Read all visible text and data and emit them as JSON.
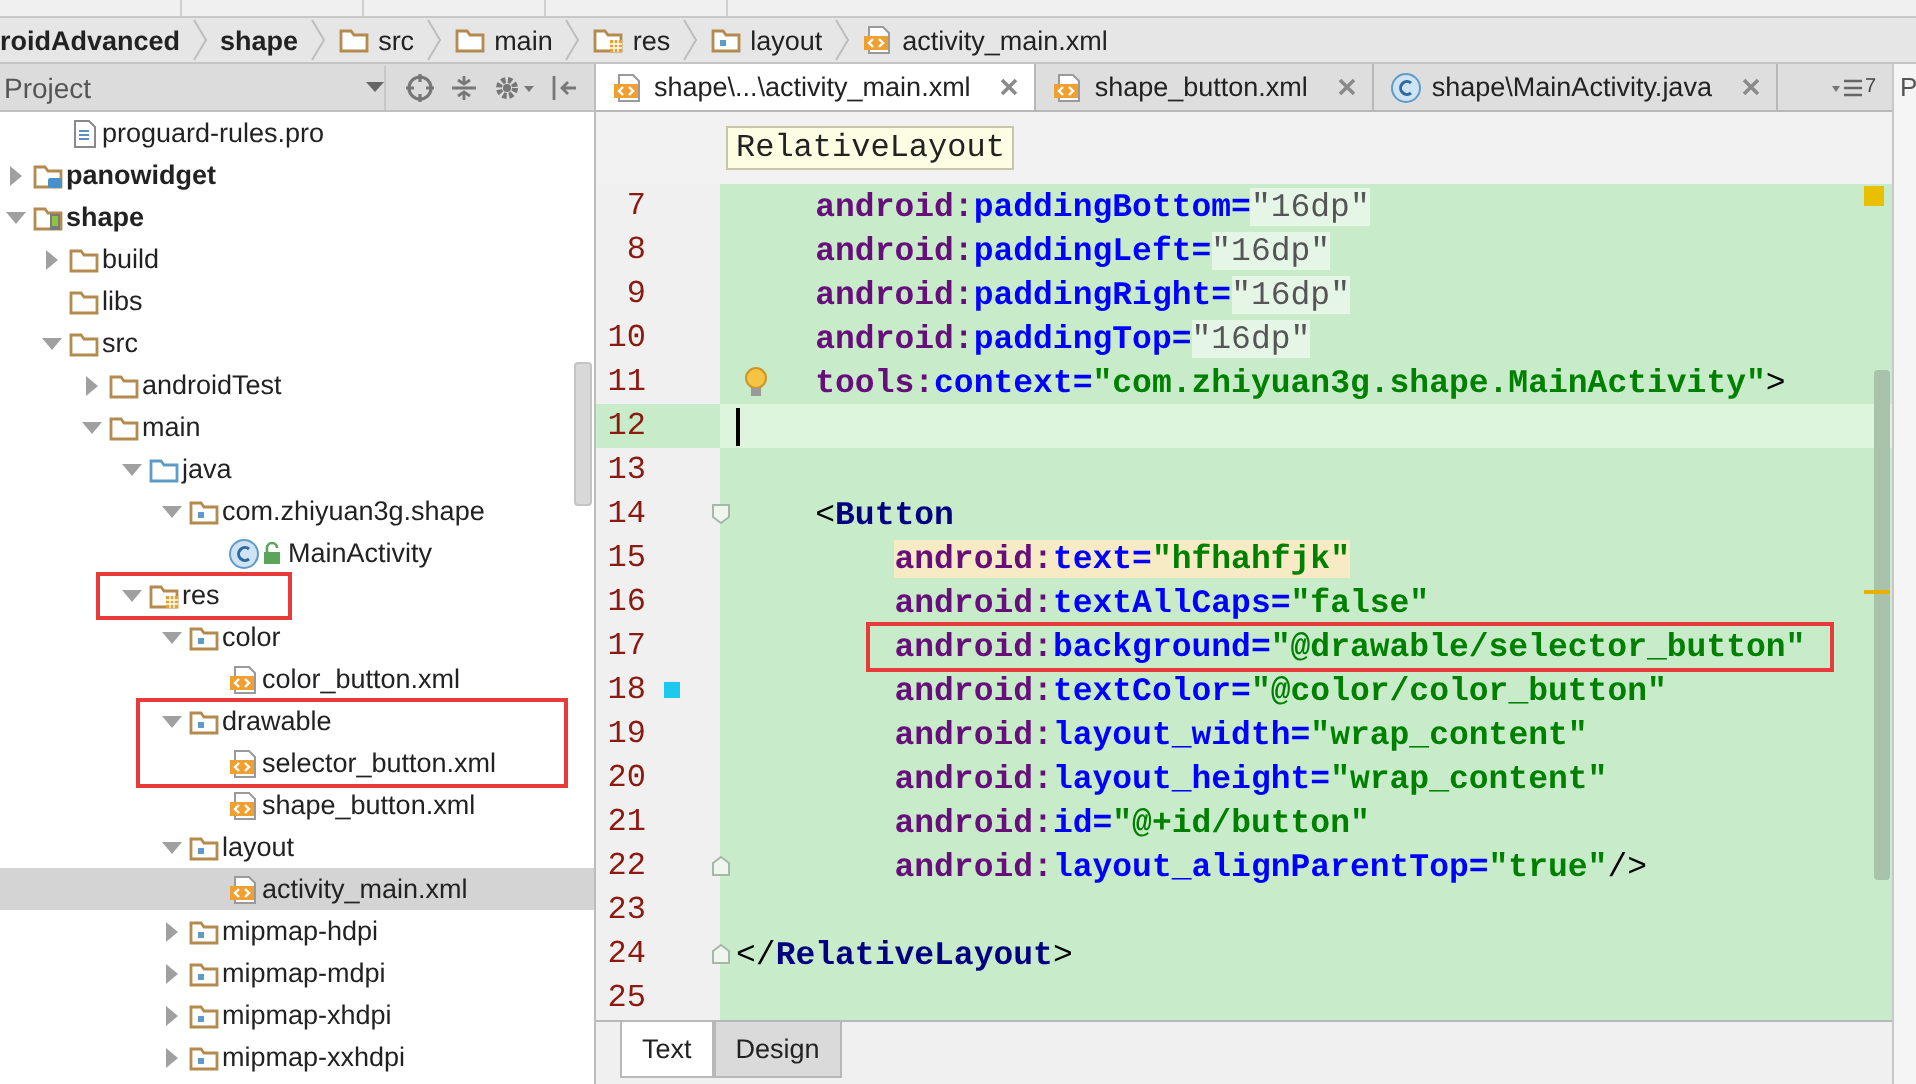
{
  "breadcrumbs": [
    {
      "label": "roidAdvanced",
      "kind": "project"
    },
    {
      "label": "shape",
      "kind": "module"
    },
    {
      "label": "src",
      "kind": "folder"
    },
    {
      "label": "main",
      "kind": "folder"
    },
    {
      "label": "res",
      "kind": "res"
    },
    {
      "label": "layout",
      "kind": "package"
    },
    {
      "label": "activity_main.xml",
      "kind": "xml"
    }
  ],
  "project_panel": {
    "title": "Project",
    "tree": {
      "continued": [
        {
          "label": "proguard-rules.pro",
          "kind": "text_file",
          "selected": false,
          "highlighted": false
        }
      ],
      "items": [
        {
          "label": "panowidget",
          "kind": "module_lib",
          "expanded": false,
          "selected": false,
          "highlighted": false
        },
        {
          "label": "shape",
          "kind": "module_app",
          "expanded": true,
          "selected": false,
          "highlighted": false,
          "children": [
            {
              "label": "build",
              "kind": "folder",
              "expanded": false,
              "selected": false,
              "highlighted": false
            },
            {
              "label": "libs",
              "kind": "folder",
              "selected": false,
              "highlighted": false
            },
            {
              "label": "src",
              "kind": "folder",
              "expanded": true,
              "selected": false,
              "highlighted": false,
              "children": [
                {
                  "label": "androidTest",
                  "kind": "folder",
                  "expanded": false,
                  "selected": false,
                  "highlighted": false
                },
                {
                  "label": "main",
                  "kind": "folder",
                  "expanded": true,
                  "selected": false,
                  "highlighted": false,
                  "children": [
                    {
                      "label": "java",
                      "kind": "source",
                      "expanded": true,
                      "selected": false,
                      "highlighted": false,
                      "children": [
                        {
                          "label": "com.zhiyuan3g.shape",
                          "kind": "package",
                          "expanded": true,
                          "selected": false,
                          "highlighted": false,
                          "children": [
                            {
                              "label": "MainActivity",
                              "kind": "class",
                              "selected": false,
                              "highlighted": false
                            }
                          ]
                        }
                      ]
                    },
                    {
                      "label": "res",
                      "kind": "res",
                      "expanded": true,
                      "selected": false,
                      "highlighted": true,
                      "children": [
                        {
                          "label": "color",
                          "kind": "package",
                          "expanded": true,
                          "selected": false,
                          "highlighted": false,
                          "children": [
                            {
                              "label": "color_button.xml",
                              "kind": "xml",
                              "selected": false,
                              "highlighted": false
                            }
                          ]
                        },
                        {
                          "label": "drawable",
                          "kind": "package",
                          "expanded": true,
                          "selected": false,
                          "highlighted": true,
                          "children": [
                            {
                              "label": "selector_button.xml",
                              "kind": "xml",
                              "selected": false,
                              "highlighted": true
                            },
                            {
                              "label": "shape_button.xml",
                              "kind": "xml",
                              "selected": false,
                              "highlighted": false
                            }
                          ]
                        },
                        {
                          "label": "layout",
                          "kind": "package",
                          "expanded": true,
                          "selected": false,
                          "highlighted": false,
                          "children": [
                            {
                              "label": "activity_main.xml",
                              "kind": "xml",
                              "selected": true,
                              "highlighted": false
                            }
                          ]
                        },
                        {
                          "label": "mipmap-hdpi",
                          "kind": "package",
                          "expanded": false,
                          "selected": false,
                          "highlighted": false
                        },
                        {
                          "label": "mipmap-mdpi",
                          "kind": "package",
                          "expanded": false,
                          "selected": false,
                          "highlighted": false
                        },
                        {
                          "label": "mipmap-xhdpi",
                          "kind": "package",
                          "expanded": false,
                          "selected": false,
                          "highlighted": false
                        },
                        {
                          "label": "mipmap-xxhdpi",
                          "kind": "package",
                          "expanded": false,
                          "selected": false,
                          "highlighted": false
                        }
                      ]
                    }
                  ]
                }
              ]
            }
          ]
        }
      ]
    }
  },
  "editor": {
    "tabs": [
      {
        "label": "shape\\...\\activity_main.xml",
        "kind": "xml",
        "selected": true
      },
      {
        "label": "shape_button.xml",
        "kind": "xml",
        "selected": false
      },
      {
        "label": "shape\\MainActivity.java",
        "kind": "class",
        "selected": false
      }
    ],
    "hidden_tabs_count": "7",
    "tooltip": "RelativeLayout",
    "lines": [
      {
        "number": "7",
        "kind": "plain",
        "current": false,
        "boxed": false,
        "highlighted": false,
        "tokens": [
          {
            "kind": "ns",
            "text": "    android:"
          },
          {
            "kind": "attr",
            "text": "paddingBottom="
          },
          {
            "kind": "folded",
            "text": "\"16dp\""
          }
        ]
      },
      {
        "number": "8",
        "kind": "plain",
        "current": false,
        "boxed": false,
        "highlighted": false,
        "tokens": [
          {
            "kind": "ns",
            "text": "    android:"
          },
          {
            "kind": "attr",
            "text": "paddingLeft="
          },
          {
            "kind": "folded",
            "text": "\"16dp\""
          }
        ]
      },
      {
        "number": "9",
        "kind": "plain",
        "current": false,
        "boxed": false,
        "highlighted": false,
        "tokens": [
          {
            "kind": "ns",
            "text": "    android:"
          },
          {
            "kind": "attr",
            "text": "paddingRight="
          },
          {
            "kind": "folded",
            "text": "\"16dp\""
          }
        ]
      },
      {
        "number": "10",
        "kind": "plain",
        "current": false,
        "boxed": false,
        "highlighted": false,
        "tokens": [
          {
            "kind": "ns",
            "text": "    android:"
          },
          {
            "kind": "attr",
            "text": "paddingTop="
          },
          {
            "kind": "folded",
            "text": "\"16dp\""
          }
        ]
      },
      {
        "number": "11",
        "kind": "bulb",
        "current": false,
        "boxed": false,
        "highlighted": false,
        "tokens": [
          {
            "kind": "ns",
            "text": "    tools:"
          },
          {
            "kind": "attr",
            "text": "context="
          },
          {
            "kind": "value",
            "text": "\"com.zhiyuan3g.shape.MainActivity\""
          },
          {
            "kind": "punct",
            "text": ">"
          }
        ]
      },
      {
        "number": "12",
        "kind": "plain",
        "current": true,
        "boxed": false,
        "highlighted": false
      },
      {
        "number": "13",
        "kind": "plain",
        "current": false,
        "boxed": false,
        "highlighted": false
      },
      {
        "number": "14",
        "kind": "fold_start",
        "current": false,
        "boxed": false,
        "highlighted": false,
        "tokens": [
          {
            "kind": "punct",
            "text": "    <"
          },
          {
            "kind": "tag",
            "text": "Button"
          }
        ]
      },
      {
        "number": "15",
        "kind": "plain",
        "current": false,
        "boxed": false,
        "highlighted": true,
        "tokens": [
          {
            "kind": "ns",
            "text": "        android:"
          },
          {
            "kind": "attr",
            "text": "text="
          },
          {
            "kind": "value",
            "text": "\"hfhahfjk\""
          }
        ]
      },
      {
        "number": "16",
        "kind": "plain",
        "current": false,
        "boxed": false,
        "highlighted": false,
        "tokens": [
          {
            "kind": "ns",
            "text": "        android:"
          },
          {
            "kind": "attr",
            "text": "textAllCaps="
          },
          {
            "kind": "value",
            "text": "\"false\""
          }
        ]
      },
      {
        "number": "17",
        "kind": "plain",
        "current": false,
        "boxed": true,
        "highlighted": false,
        "tokens": [
          {
            "kind": "ns",
            "text": "        android:"
          },
          {
            "kind": "attr",
            "text": "background="
          },
          {
            "kind": "value",
            "text": "\"@drawable/selector_button\""
          }
        ]
      },
      {
        "number": "18",
        "kind": "change",
        "current": false,
        "boxed": false,
        "highlighted": false,
        "tokens": [
          {
            "kind": "ns",
            "text": "        android:"
          },
          {
            "kind": "attr",
            "text": "textColor="
          },
          {
            "kind": "value",
            "text": "\"@color/color_button\""
          }
        ]
      },
      {
        "number": "19",
        "kind": "plain",
        "current": false,
        "boxed": false,
        "highlighted": false,
        "tokens": [
          {
            "kind": "ns",
            "text": "        android:"
          },
          {
            "kind": "attr",
            "text": "layout_width="
          },
          {
            "kind": "value",
            "text": "\"wrap_content\""
          }
        ]
      },
      {
        "number": "20",
        "kind": "plain",
        "current": false,
        "boxed": false,
        "highlighted": false,
        "tokens": [
          {
            "kind": "ns",
            "text": "        android:"
          },
          {
            "kind": "attr",
            "text": "layout_height="
          },
          {
            "kind": "value",
            "text": "\"wrap_content\""
          }
        ]
      },
      {
        "number": "21",
        "kind": "plain",
        "current": false,
        "boxed": false,
        "highlighted": false,
        "tokens": [
          {
            "kind": "ns",
            "text": "        android:"
          },
          {
            "kind": "attr",
            "text": "id="
          },
          {
            "kind": "value",
            "text": "\"@+id/button\""
          }
        ]
      },
      {
        "number": "22",
        "kind": "fold_end",
        "current": false,
        "boxed": false,
        "highlighted": false,
        "tokens": [
          {
            "kind": "ns",
            "text": "        android:"
          },
          {
            "kind": "attr",
            "text": "layout_alignParentTop="
          },
          {
            "kind": "value",
            "text": "\"true\""
          },
          {
            "kind": "punct",
            "text": "/>"
          }
        ]
      },
      {
        "number": "23",
        "kind": "plain",
        "current": false,
        "boxed": false,
        "highlighted": false
      },
      {
        "number": "24",
        "kind": "fold_end",
        "current": false,
        "boxed": false,
        "highlighted": false,
        "tokens": [
          {
            "kind": "punct",
            "text": "</"
          },
          {
            "kind": "tag",
            "text": "RelativeLayout"
          },
          {
            "kind": "punct",
            "text": ">"
          }
        ]
      },
      {
        "number": "25",
        "kind": "plain",
        "current": false,
        "boxed": false,
        "highlighted": false
      }
    ],
    "bottom_tabs": [
      {
        "label": "Text",
        "selected": true
      },
      {
        "label": "Design",
        "selected": false
      }
    ]
  },
  "right_toolbar": {
    "label": "P"
  }
}
